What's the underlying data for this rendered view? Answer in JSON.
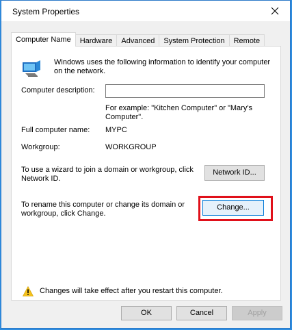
{
  "window": {
    "title": "System Properties"
  },
  "tabs": [
    {
      "label": "Computer Name",
      "active": true
    },
    {
      "label": "Hardware",
      "active": false
    },
    {
      "label": "Advanced",
      "active": false
    },
    {
      "label": "System Protection",
      "active": false
    },
    {
      "label": "Remote",
      "active": false
    }
  ],
  "computer_name": {
    "intro": "Windows uses the following information to identify your computer on the network.",
    "description_label": "Computer description:",
    "description_value": "",
    "description_example": "For example: \"Kitchen Computer\" or \"Mary's Computer\".",
    "full_name_label": "Full computer name:",
    "full_name_value": "MYPC",
    "workgroup_label": "Workgroup:",
    "workgroup_value": "WORKGROUP",
    "network_id_text": "To use a wizard to join a domain or workgroup, click Network ID.",
    "network_id_button": "Network ID...",
    "rename_text": "To rename this computer or change its domain or workgroup, click Change.",
    "change_button": "Change...",
    "warning_text": "Changes will take effect after you restart this computer."
  },
  "buttons": {
    "ok": "OK",
    "cancel": "Cancel",
    "apply": "Apply"
  },
  "colors": {
    "highlight": "#e0101a",
    "focus": "#0078d7",
    "desktop": "#2f8de0"
  },
  "icons": {
    "close": "close-icon",
    "computer": "computer-icon",
    "warning": "warning-icon"
  }
}
